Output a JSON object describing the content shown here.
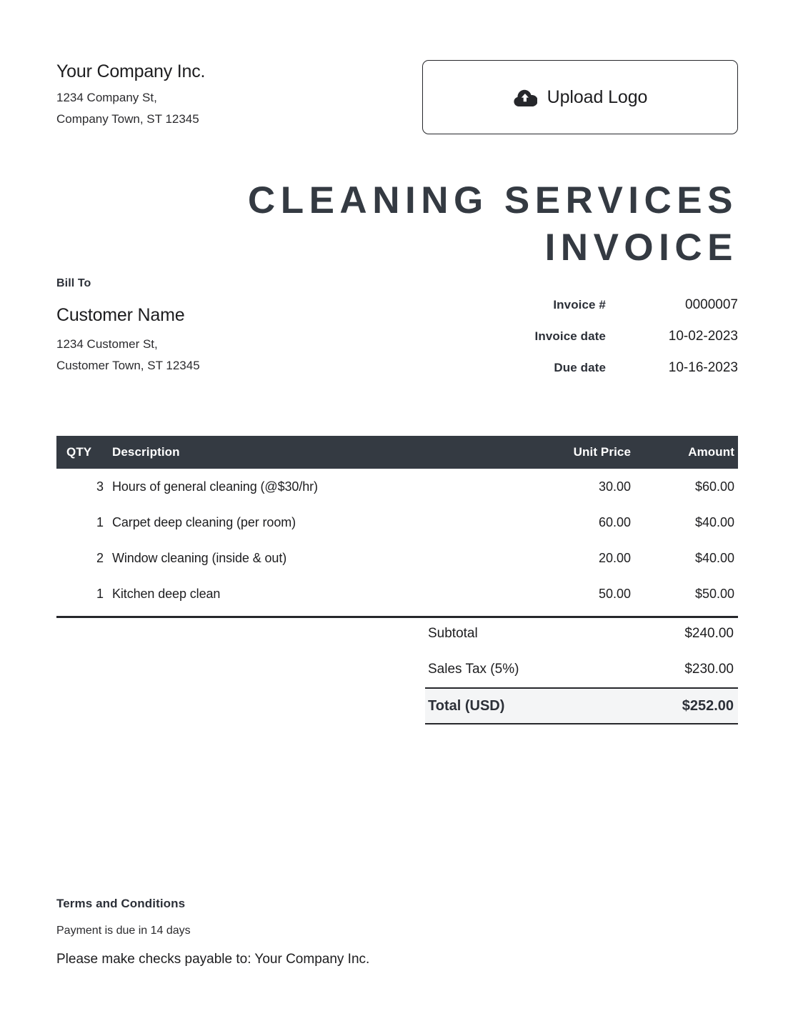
{
  "company": {
    "name": "Your Company Inc.",
    "address_line1": "1234 Company St,",
    "address_line2": "Company Town, ST 12345"
  },
  "upload": {
    "label": "Upload Logo",
    "icon": "cloud-upload-icon"
  },
  "title": "CLEANING SERVICES INVOICE",
  "bill_to": {
    "label": "Bill To",
    "customer_name": "Customer Name",
    "address_line1": "1234 Customer St,",
    "address_line2": "Customer Town, ST 12345"
  },
  "meta": {
    "invoice_number_label": "Invoice #",
    "invoice_number": "0000007",
    "invoice_date_label": "Invoice date",
    "invoice_date": "10-02-2023",
    "due_date_label": "Due date",
    "due_date": "10-16-2023"
  },
  "table": {
    "headers": {
      "qty": "QTY",
      "description": "Description",
      "unit_price": "Unit Price",
      "amount": "Amount"
    },
    "rows": [
      {
        "qty": "3",
        "description": "Hours of general cleaning (@$30/hr)",
        "unit_price": "30.00",
        "amount": "$60.00"
      },
      {
        "qty": "1",
        "description": "Carpet deep cleaning (per room)",
        "unit_price": "60.00",
        "amount": "$40.00"
      },
      {
        "qty": "2",
        "description": "Window cleaning (inside & out)",
        "unit_price": "20.00",
        "amount": "$40.00"
      },
      {
        "qty": "1",
        "description": "Kitchen deep clean",
        "unit_price": "50.00",
        "amount": "$50.00"
      }
    ]
  },
  "totals": {
    "subtotal_label": "Subtotal",
    "subtotal_value": "$240.00",
    "tax_label": "Sales Tax (5%)",
    "tax_value": "$230.00",
    "total_label": "Total (USD)",
    "total_value": "$252.00"
  },
  "terms": {
    "title": "Terms and Conditions",
    "line1": "Payment is due in 14 days",
    "line2": "Please make checks payable to: Your Company Inc."
  },
  "colors": {
    "dark": "#343a42",
    "text": "#1d1d1f",
    "total_bg": "#f4f5f6"
  }
}
